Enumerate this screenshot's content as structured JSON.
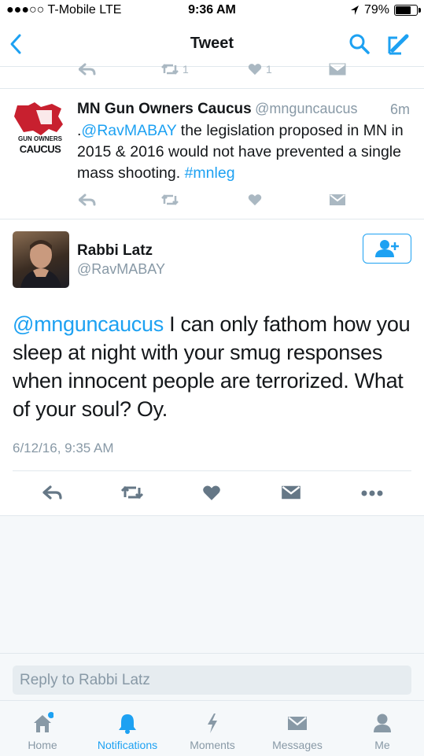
{
  "status_bar": {
    "carrier": "●●●○○ T-Mobile  LTE",
    "time": "9:36 AM",
    "battery": "79%",
    "battery_level": 0.79
  },
  "nav": {
    "title": "Tweet",
    "back_icon": "chevron-left-icon",
    "search_icon": "search-icon",
    "compose_icon": "compose-icon"
  },
  "prev_actions": {
    "retweet_count": "1",
    "like_count": "1"
  },
  "reply_tweet": {
    "avatar_text_top": "GUN OWNERS",
    "avatar_text_bottom": "CAUCUS",
    "name": "MN Gun Owners Caucus",
    "handle": "@mnguncaucus",
    "time": "6m",
    "text_prefix": ".",
    "mention": "@RavMABAY",
    "text_body": " the legislation proposed in MN in 2015 & 2016 would not have prevented a single mass shooting. ",
    "hashtag": "#mnleg"
  },
  "main_tweet": {
    "name": "Rabbi Latz",
    "handle": "@RavMABAY",
    "mention": "@mnguncaucus",
    "text_body": " I can only fathom how you sleep at night with your smug responses when innocent people are terrorized. What of your soul? Oy.",
    "timestamp": "6/12/16, 9:35 AM"
  },
  "reply_bar": {
    "placeholder": "Reply to Rabbi Latz"
  },
  "tabs": [
    {
      "label": "Home",
      "icon": "home-icon"
    },
    {
      "label": "Notifications",
      "icon": "bell-icon"
    },
    {
      "label": "Moments",
      "icon": "lightning-icon"
    },
    {
      "label": "Messages",
      "icon": "envelope-icon"
    },
    {
      "label": "Me",
      "icon": "person-icon"
    }
  ],
  "colors": {
    "accent": "#1da1f2",
    "muted": "#8899a6",
    "icon_gray": "#aab8c2"
  }
}
